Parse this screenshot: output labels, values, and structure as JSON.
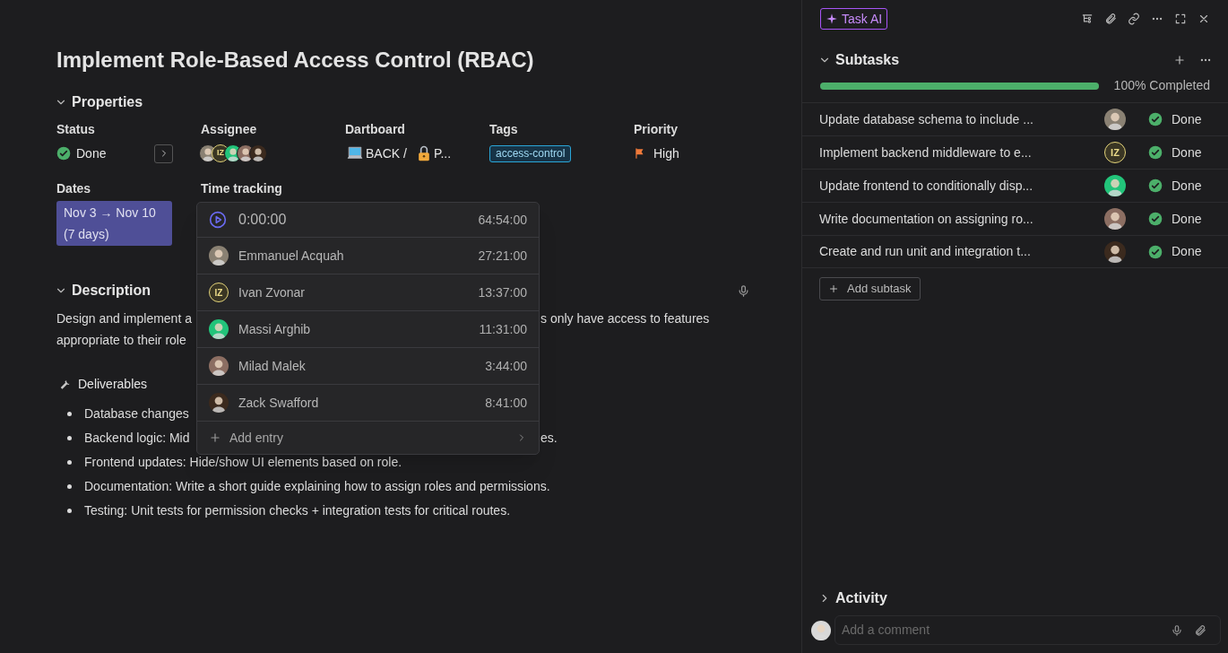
{
  "task": {
    "title": "Implement Role-Based Access Control (RBAC)"
  },
  "properties": {
    "heading": "Properties",
    "expanded": true,
    "status": {
      "label": "Status",
      "value": "Done",
      "done": true
    },
    "assignee": {
      "label": "Assignee",
      "avatars": [
        {
          "kind": "photo",
          "color": "#8a8173"
        },
        {
          "kind": "initials",
          "initials": "IZ"
        },
        {
          "kind": "photo",
          "color": "#22c47a"
        },
        {
          "kind": "photo",
          "color": "#8c6e62"
        },
        {
          "kind": "photo",
          "color": "#3b2a1e"
        }
      ]
    },
    "dartboard": {
      "label": "Dartboard",
      "parent": "BACK /",
      "child": "P..."
    },
    "tags": {
      "label": "Tags",
      "items": [
        "access-control"
      ]
    },
    "priority": {
      "label": "Priority",
      "value": "High",
      "color": "#f07a3a"
    },
    "dates": {
      "label": "Dates",
      "range": "Nov 3 → Nov 10",
      "duration": "(7 days)"
    },
    "time_tracking": {
      "label": "Time tracking"
    }
  },
  "time_popover": {
    "timer": "0:00:00",
    "total": "64:54:00",
    "entries": [
      {
        "name": "Emmanuel Acquah",
        "time": "27:21:00",
        "avatar": {
          "kind": "photo",
          "color": "#8a8173"
        }
      },
      {
        "name": "Ivan Zvonar",
        "time": "13:37:00",
        "avatar": {
          "kind": "initials",
          "initials": "IZ"
        }
      },
      {
        "name": "Massi Arghib",
        "time": "11:31:00",
        "avatar": {
          "kind": "photo",
          "color": "#22c47a"
        }
      },
      {
        "name": "Milad Malek",
        "time": "3:44:00",
        "avatar": {
          "kind": "photo",
          "color": "#8c6e62"
        }
      },
      {
        "name": "Zack Swafford",
        "time": "8:41:00",
        "avatar": {
          "kind": "photo",
          "color": "#3b2a1e"
        }
      }
    ],
    "add_entry": "Add entry"
  },
  "description": {
    "heading": "Description",
    "expanded": true,
    "lines": [
      {
        "left": "Design and implement a",
        "right": "s only have access to features"
      },
      {
        "left": "appropriate to their role"
      }
    ],
    "deliverables_heading": "Deliverables",
    "bullets": [
      {
        "left": "Database changes"
      },
      {
        "left": "Backend logic: Mid",
        "right": "es."
      },
      {
        "left": "Frontend updates: Hide/show UI elements based on role."
      },
      {
        "left": "Documentation: Write a short guide explaining how to assign roles and permissions."
      },
      {
        "left": "Testing: Unit tests for permission checks + integration tests for critical routes."
      }
    ]
  },
  "side_panel": {
    "task_ai": "Task AI",
    "subtasks": {
      "heading": "Subtasks",
      "expanded": true,
      "level": 1,
      "progress_text": "100% Completed",
      "items": [
        {
          "title": "Update database schema to include ...",
          "status": "Done",
          "done": true,
          "avatar": {
            "kind": "photo",
            "color": "#8a8173"
          }
        },
        {
          "title": "Implement backend middleware to e...",
          "status": "Done",
          "done": true,
          "avatar": {
            "kind": "initials",
            "initials": "IZ"
          }
        },
        {
          "title": "Update frontend to conditionally disp...",
          "status": "Done",
          "done": true,
          "avatar": {
            "kind": "photo",
            "color": "#22c47a"
          }
        },
        {
          "title": "Write documentation on assigning ro...",
          "status": "Done",
          "done": true,
          "avatar": {
            "kind": "photo",
            "color": "#8c6e62"
          }
        },
        {
          "title": "Create and run unit and integration t...",
          "status": "Done",
          "done": true,
          "avatar": {
            "kind": "photo",
            "color": "#3b2a1e"
          }
        }
      ],
      "add_subtask": "Add subtask"
    },
    "activity": {
      "heading": "Activity",
      "expanded": false
    },
    "comment": {
      "placeholder": "Add a comment",
      "avatar": {
        "kind": "photo",
        "color": "#d8d8d8"
      }
    }
  }
}
